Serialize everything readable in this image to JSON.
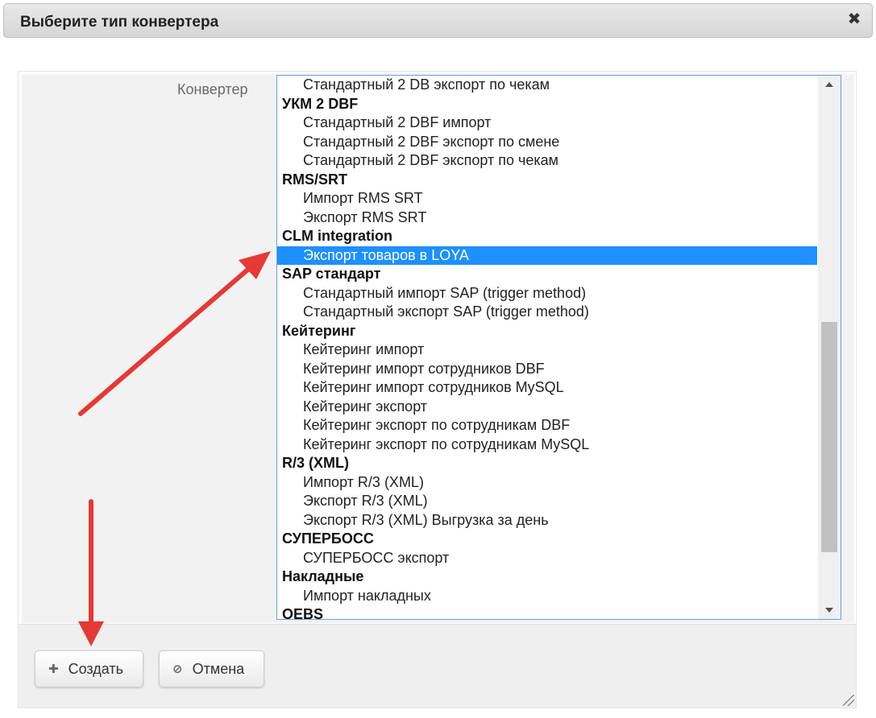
{
  "dialog": {
    "title": "Выберите тип конвертера",
    "close_symbol": "✖"
  },
  "form": {
    "converter_label": "Конвертер"
  },
  "converter_list": [
    {
      "type": "option",
      "label": "Стандартный 2 DB экспорт по чекам"
    },
    {
      "type": "group",
      "label": "УКМ 2 DBF"
    },
    {
      "type": "option",
      "label": "Стандартный 2 DBF импорт"
    },
    {
      "type": "option",
      "label": "Стандартный 2 DBF экспорт по смене"
    },
    {
      "type": "option",
      "label": "Стандартный 2 DBF экспорт по чекам"
    },
    {
      "type": "group",
      "label": "RMS/SRT"
    },
    {
      "type": "option",
      "label": "Импорт RMS SRT"
    },
    {
      "type": "option",
      "label": "Экспорт RMS SRT"
    },
    {
      "type": "group",
      "label": "CLM integration"
    },
    {
      "type": "option",
      "label": "Экспорт товаров в LOYA",
      "selected": true
    },
    {
      "type": "group",
      "label": "SAP стандарт"
    },
    {
      "type": "option",
      "label": "Стандартный импорт SAP (trigger method)"
    },
    {
      "type": "option",
      "label": "Стандартный экспорт SAP (trigger method)"
    },
    {
      "type": "group",
      "label": "Кейтеринг"
    },
    {
      "type": "option",
      "label": "Кейтеринг импорт"
    },
    {
      "type": "option",
      "label": "Кейтеринг импорт сотрудников DBF"
    },
    {
      "type": "option",
      "label": "Кейтеринг импорт сотрудников MySQL"
    },
    {
      "type": "option",
      "label": "Кейтеринг экспорт"
    },
    {
      "type": "option",
      "label": "Кейтеринг экспорт по сотрудникам DBF"
    },
    {
      "type": "option",
      "label": "Кейтеринг экспорт по сотрудникам MySQL"
    },
    {
      "type": "group",
      "label": "R/3 (XML)"
    },
    {
      "type": "option",
      "label": "Импорт R/3 (XML)"
    },
    {
      "type": "option",
      "label": "Экспорт R/3 (XML)"
    },
    {
      "type": "option",
      "label": "Экспорт R/3 (XML) Выгрузка за день"
    },
    {
      "type": "group",
      "label": "СУПЕРБОСС"
    },
    {
      "type": "option",
      "label": "СУПЕРБОСС экспорт"
    },
    {
      "type": "group",
      "label": "Накладные"
    },
    {
      "type": "option",
      "label": "Импорт накладных"
    },
    {
      "type": "group",
      "label": "OEBS"
    }
  ],
  "buttons": {
    "create_label": "Создать",
    "create_icon": "plus-icon",
    "cancel_label": "Отмена",
    "cancel_icon": "cancel-icon"
  },
  "colors": {
    "selection": "#1e90ff",
    "annotation_arrow": "#e53935"
  }
}
